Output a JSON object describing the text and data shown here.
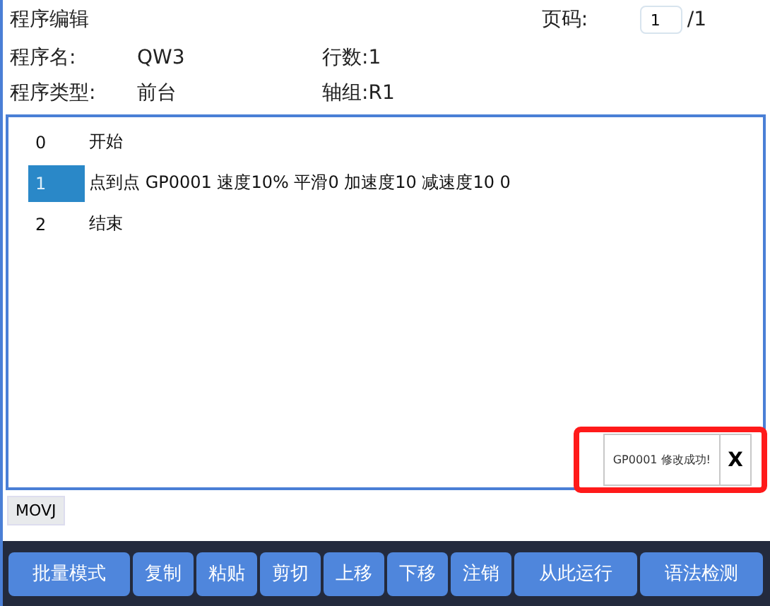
{
  "header": {
    "title": "程序编辑",
    "page_label": "页码:",
    "page_value": "1",
    "page_total": "/1"
  },
  "info": [
    {
      "label": "程序名:",
      "value": "QW3",
      "extra": "行数:1"
    },
    {
      "label": "程序类型:",
      "value": "前台",
      "extra": "轴组:R1"
    }
  ],
  "program_lines": [
    {
      "index": "0",
      "text": "开始",
      "selected": false
    },
    {
      "index": "1",
      "text": "点到点 GP0001 速度10% 平滑0 加速度10 减速度10 0",
      "selected": true
    },
    {
      "index": "2",
      "text": "结束",
      "selected": false
    }
  ],
  "toast": {
    "message": "GP0001 修改成功!",
    "close": "X"
  },
  "command_tag": "MOVJ",
  "buttons": [
    "批量模式",
    "复制",
    "粘贴",
    "剪切",
    "上移",
    "下移",
    "注销",
    "从此运行",
    "语法检测"
  ]
}
